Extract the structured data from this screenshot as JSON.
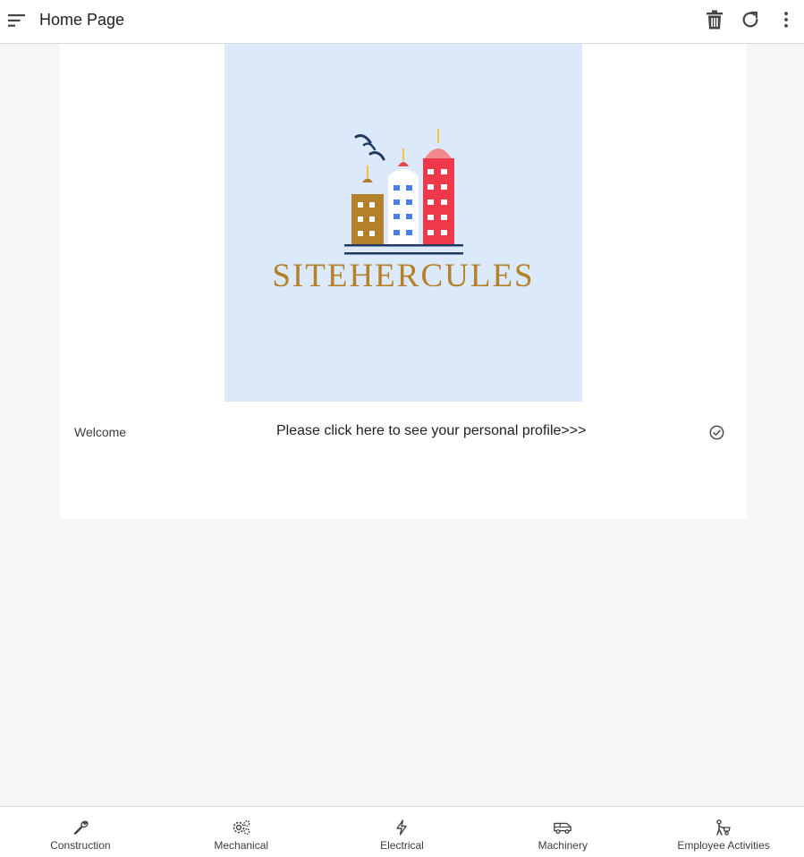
{
  "header": {
    "title": "Home Page",
    "icons": [
      "sort-menu-icon",
      "delete-icon",
      "refresh-icon",
      "more-vertical-icon"
    ]
  },
  "logo": {
    "brand_text": "SITEHERCULES",
    "background_color": "#dce9fb",
    "text_color": "#b4812a"
  },
  "welcome": {
    "label": "Welcome",
    "profile_link": "Please click here to see your personal profile>>>",
    "icon": "check-circle-icon"
  },
  "bottom_nav": {
    "items": [
      {
        "label": "Construction",
        "icon": "wrench-icon"
      },
      {
        "label": "Mechanical",
        "icon": "gears-icon"
      },
      {
        "label": "Electrical",
        "icon": "lightning-icon"
      },
      {
        "label": "Machinery",
        "icon": "van-icon"
      },
      {
        "label": "Employee Activities",
        "icon": "worker-icon"
      }
    ]
  }
}
